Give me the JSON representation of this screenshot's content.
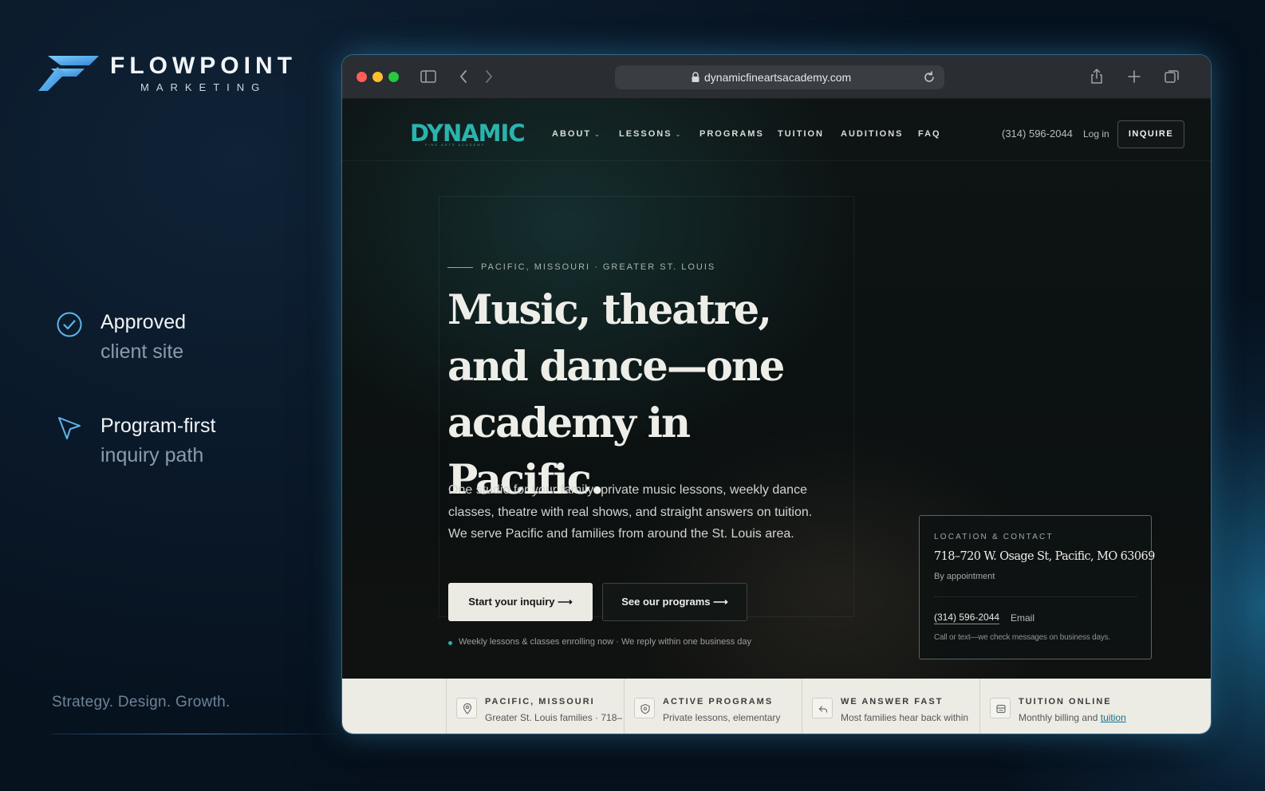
{
  "brand": {
    "name": "FLOWPOINT",
    "sub": "MARKETING",
    "tagline": "Strategy. Design. Growth."
  },
  "features": [
    {
      "icon": "check-circle-icon",
      "title": "Approved",
      "sub": "client site"
    },
    {
      "icon": "cursor-arrow-icon",
      "title": "Program-first",
      "sub": "inquiry path"
    }
  ],
  "browser": {
    "url": "dynamicfineartsacademy.com"
  },
  "site": {
    "logo": "DYNAMIC",
    "logo_sub": "FINE ARTS ACADEMY",
    "accent": "#2bb3ad",
    "nav": {
      "items": [
        {
          "label": "ABOUT",
          "dropdown": true
        },
        {
          "label": "LESSONS",
          "dropdown": true
        },
        {
          "label": "PROGRAMS",
          "dropdown": false
        },
        {
          "label": "TUITION",
          "dropdown": false
        },
        {
          "label": "AUDITIONS",
          "dropdown": false
        },
        {
          "label": "FAQ",
          "dropdown": false
        }
      ],
      "caret": "⌄",
      "phone": "(314) 596-2044",
      "login": "Log in",
      "cta": "INQUIRE"
    },
    "hero": {
      "eyebrow": "PACIFIC, MISSOURI · GREATER ST. LOUIS",
      "title": "Music, theatre, and dance—one academy in Pacific.",
      "body": "One studio for your family: private music lessons, weekly dance classes, theatre with real shows, and straight answers on tuition. We serve Pacific and families from around the St. Louis area.",
      "primary_cta": "Start your inquiry  ⟶",
      "secondary_cta": "See our programs  ⟶",
      "status": "Weekly lessons & classes enrolling now · We reply within one business day"
    },
    "contact": {
      "label": "LOCATION & CONTACT",
      "address": "718–720 W. Osage St, Pacific, MO 63069",
      "appointment": "By appointment",
      "phone": "(314) 596-2044",
      "email": "Email",
      "note": "Call or text—we check messages on business days."
    },
    "info_strip": [
      {
        "icon": "map-pin-icon",
        "title": "PACIFIC, MISSOURI",
        "text": "Greater St. Louis families · 718–"
      },
      {
        "icon": "shield-icon",
        "title": "ACTIVE PROGRAMS",
        "text": "Private lessons, elementary"
      },
      {
        "icon": "reply-icon",
        "title": "WE ANSWER FAST",
        "text": "Most families hear back within"
      },
      {
        "icon": "receipt-icon",
        "title": "TUITION ONLINE",
        "text": "Monthly billing and ",
        "link": "tuition"
      }
    ]
  }
}
